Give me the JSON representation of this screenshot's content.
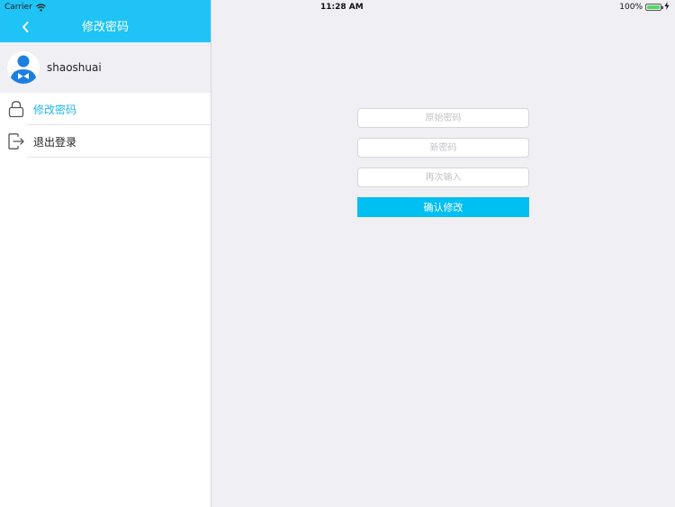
{
  "status_bar": {
    "carrier": "Carrier",
    "time": "11:28 AM",
    "battery": "100%",
    "battery_level": 1.0
  },
  "sidebar": {
    "title": "修改密码",
    "username": "shaoshuai",
    "items": [
      {
        "label": "修改密码",
        "icon": "lock-icon",
        "active": true
      },
      {
        "label": "退出登录",
        "icon": "logout-icon",
        "active": false
      }
    ]
  },
  "form": {
    "old_password_placeholder": "原始密码",
    "new_password_placeholder": "新密码",
    "confirm_password_placeholder": "再次输入",
    "submit_label": "确认修改"
  },
  "colors": {
    "accent": "#1fc3f5",
    "active_text": "#1fb6ea",
    "button": "#00bff3",
    "background": "#efeff4"
  }
}
